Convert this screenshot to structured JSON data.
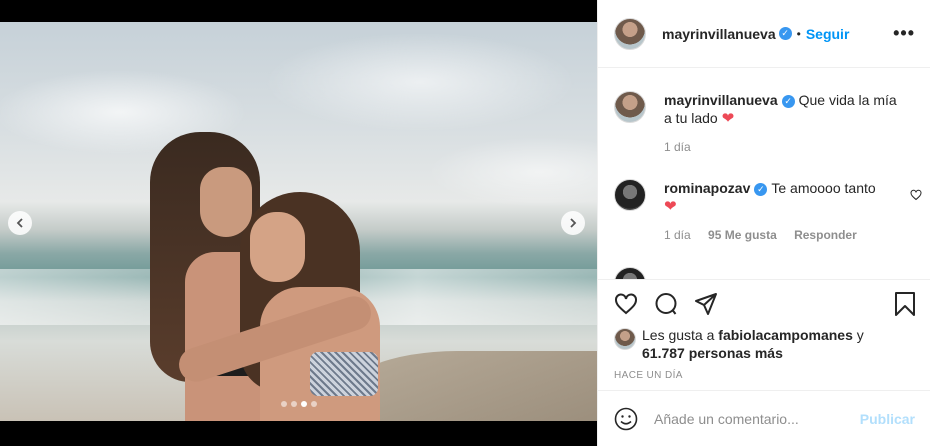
{
  "post": {
    "image_alt": "",
    "carousel": {
      "dot_count": 4,
      "active_index": 2
    }
  },
  "header": {
    "username": "mayrinvillanueva",
    "separator": "•",
    "follow_label": "Seguir",
    "more_label": "•••"
  },
  "caption": {
    "username": "mayrinvillanueva",
    "text": "Que vida la mía a tu lado",
    "emoji": "❤",
    "time": "1 día"
  },
  "comments": [
    {
      "username": "rominapozav",
      "text": "Te amoooo tanto",
      "emoji": "❤",
      "time": "1 día",
      "likes": "95 Me gusta",
      "reply_label": "Responder"
    }
  ],
  "actions": {
    "likes_prefix": "Les gusta a",
    "likes_user": "fabiolacampomanes",
    "likes_suffix": "y",
    "likes_count": "61.787 personas más",
    "time_ago": "HACE UN DÍA"
  },
  "add_comment": {
    "placeholder": "Añade un comentario...",
    "publish_label": "Publicar"
  },
  "colors": {
    "accent": "#0095f6",
    "verified": "#3897f0",
    "heart": "#ed4956",
    "muted": "#8e8e8e"
  },
  "icons": [
    "chevron-left-icon",
    "chevron-right-icon",
    "verified-icon",
    "more-icon",
    "heart-icon",
    "comment-icon",
    "share-icon",
    "bookmark-icon",
    "emoji-icon"
  ]
}
